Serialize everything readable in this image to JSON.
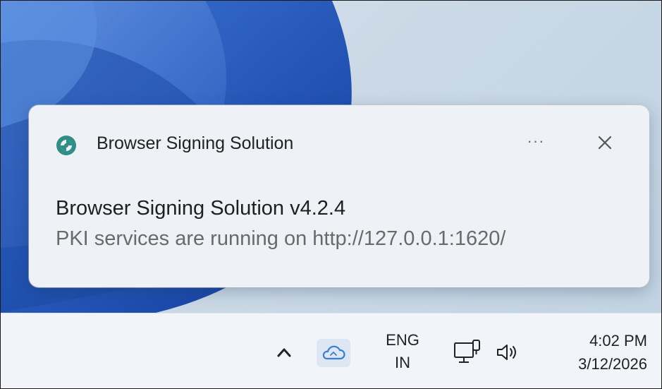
{
  "notification": {
    "app_name": "Browser Signing Solution",
    "more_label": "···",
    "title": "Browser Signing Solution v4.2.4",
    "body": "PKI services are running on http://127.0.0.1:1620/",
    "app_icon": "browser-signing-app-icon",
    "close_icon": "close-icon"
  },
  "taskbar": {
    "tray_icons": [
      "chevron-up-icon",
      "onedrive-cloud-icon",
      "network-icon",
      "volume-icon"
    ],
    "language_line1": "ENG",
    "language_line2": "IN",
    "time": "4:02 PM",
    "date": "3/12/2026"
  },
  "colors": {
    "wallpaper_blue": "#1e4fb3",
    "wallpaper_light": "#cbd9e6",
    "cloud_icon": "#3a7fd6",
    "app_icon_teal": "#2f8f86"
  }
}
